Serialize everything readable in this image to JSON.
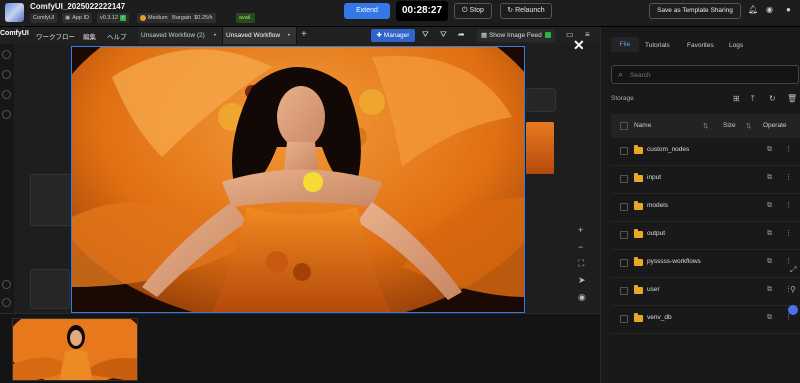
{
  "header": {
    "project_title": "ComfyUI_2025022222147",
    "chips": {
      "app": "ComfyUI",
      "app_id": "App ID",
      "version": "v0.3.12",
      "gpu_tier": "Medium",
      "plan": "Bargain",
      "price": "$0.25/h",
      "avail": "avail."
    },
    "extend_label": "Extend",
    "timer": "00:28:27",
    "stop_label": "Stop",
    "relaunch_label": "Relaunch",
    "template_label": "Save as Template Sharing",
    "icons": [
      "bell-icon",
      "discord-icon",
      "user-icon"
    ]
  },
  "menubar": {
    "logo": "ComfyUI",
    "menus": [
      "ワークフロー",
      "編集",
      "ヘルプ"
    ],
    "tabs": [
      {
        "label": "Unsaved Workflow (2)",
        "marker": "•"
      },
      {
        "label": "Unsaved Workflow",
        "marker": "•"
      }
    ],
    "add_tab": "+",
    "manager_label": "Manager",
    "image_feed_label": "Show Image Feed"
  },
  "canvas": {
    "close_symbol": "✕",
    "zoom_in": "+",
    "zoom_out": "−"
  },
  "right_panel": {
    "tabs": [
      "File",
      "Tutorials",
      "Favorites",
      "Logs"
    ],
    "active_tab": "File",
    "search_placeholder": "Search",
    "storage_label": "Storage",
    "columns": {
      "name": "Name",
      "size": "Size",
      "operate": "Operate"
    },
    "files": [
      {
        "name": "custom_nodes"
      },
      {
        "name": "input"
      },
      {
        "name": "models"
      },
      {
        "name": "output"
      },
      {
        "name": "pysssss-workflows"
      },
      {
        "name": "user"
      },
      {
        "name": "venv_db"
      }
    ]
  },
  "colors": {
    "accent": "#3477e6",
    "folder": "#e7a825",
    "selection_border": "#2f7de8"
  }
}
